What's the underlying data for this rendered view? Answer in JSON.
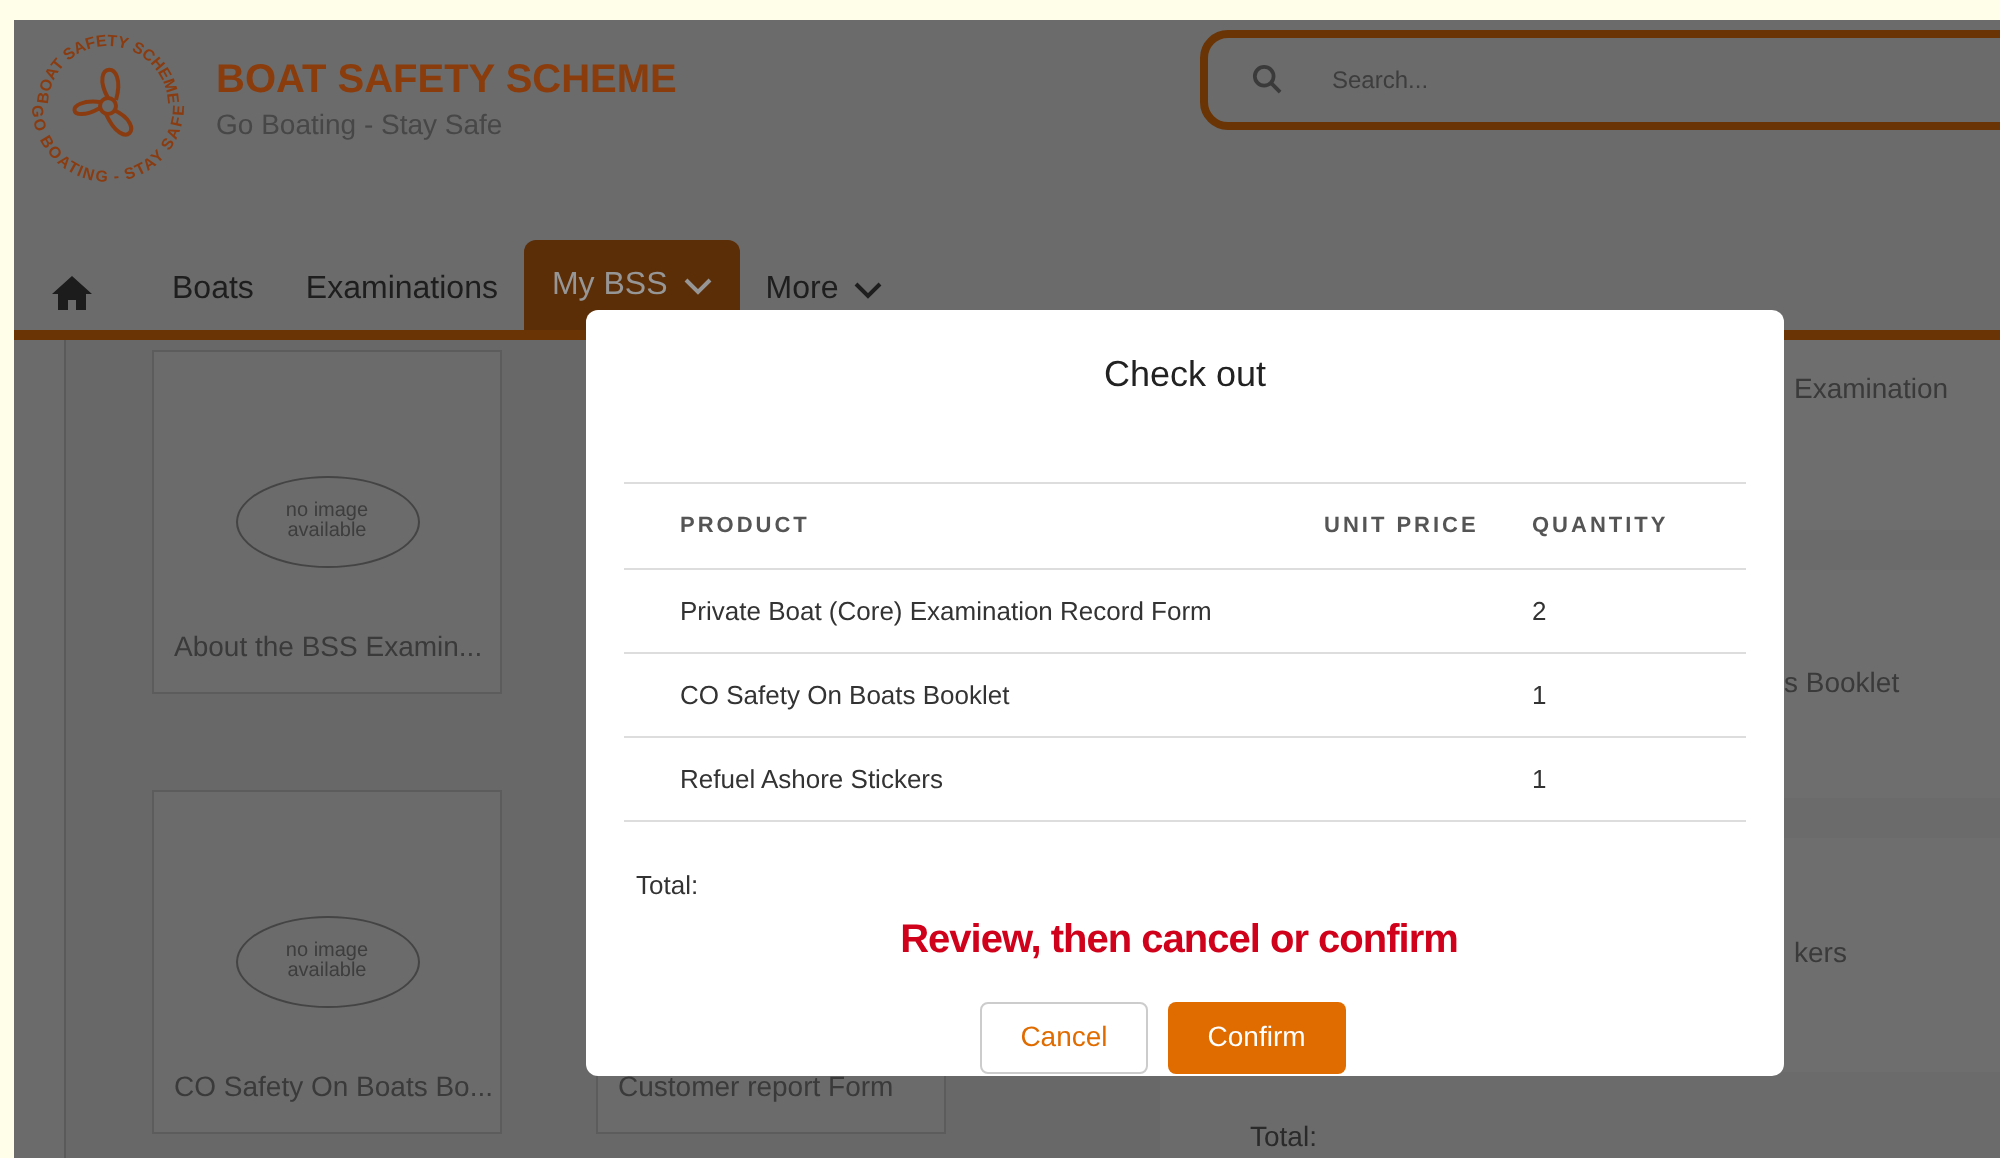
{
  "header": {
    "logo": {
      "ring_top": "BOAT SAFETY SCHEME",
      "ring_bottom": "GO BOATING - STAY SAFE"
    },
    "title": "BOAT SAFETY SCHEME",
    "subtitle": "Go Boating - Stay Safe",
    "search": {
      "placeholder": "Search..."
    }
  },
  "nav": [
    {
      "label": "Boats",
      "selected": false,
      "has_menu": false
    },
    {
      "label": "Examinations",
      "selected": false,
      "has_menu": false
    },
    {
      "label": "My BSS",
      "selected": true,
      "has_menu": true
    },
    {
      "label": "More",
      "selected": false,
      "has_menu": true
    }
  ],
  "cards": [
    {
      "image_text": "no image available",
      "title": "About the BSS Examin..."
    },
    {
      "image_text": "no image available",
      "title": "CO Safety On Boats Bo..."
    },
    {
      "title": "Customer report Form"
    }
  ],
  "cart_panel": {
    "rows": [
      "Examination",
      "s Booklet",
      "kers"
    ],
    "total_label": "Total:"
  },
  "modal": {
    "title": "Check out",
    "columns": [
      "PRODUCT",
      "UNIT PRICE",
      "QUANTITY"
    ],
    "rows": [
      {
        "product": "Private Boat (Core) Examination Record Form",
        "quantity": "2"
      },
      {
        "product": "CO Safety On Boats Booklet",
        "quantity": "1"
      },
      {
        "product": "Refuel Ashore Stickers",
        "quantity": "1"
      }
    ],
    "total_label": "Total:",
    "notice": "Review, then cancel or confirm",
    "buttons": [
      {
        "label": "Cancel",
        "kind": "secondary"
      },
      {
        "label": "Confirm",
        "kind": "primary"
      }
    ]
  }
}
